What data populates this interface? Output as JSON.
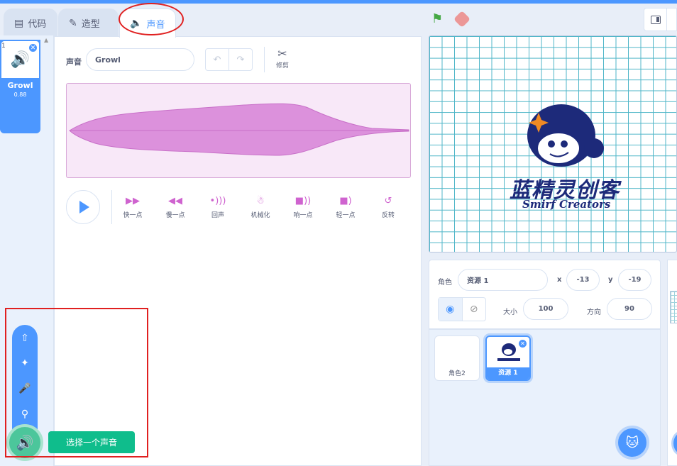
{
  "tabs": [
    {
      "label": "代码",
      "icon": "code-blocks-icon"
    },
    {
      "label": "造型",
      "icon": "brush-icon"
    },
    {
      "label": "声音",
      "icon": "speaker-icon"
    }
  ],
  "sound_list": {
    "items": [
      {
        "index": "1",
        "name": "Growl",
        "duration": "0.88"
      }
    ]
  },
  "editor": {
    "sound_label": "声音",
    "sound_name": "Growl",
    "trim_label": "修剪",
    "effects": [
      {
        "label": "快一点",
        "icon": "faster-icon"
      },
      {
        "label": "慢一点",
        "icon": "slower-icon"
      },
      {
        "label": "回声",
        "icon": "echo-icon"
      },
      {
        "label": "机械化",
        "icon": "robot-icon"
      },
      {
        "label": "响一点",
        "icon": "louder-icon"
      },
      {
        "label": "轻一点",
        "icon": "softer-icon"
      },
      {
        "label": "反转",
        "icon": "reverse-icon"
      }
    ],
    "waveform_color": "#cf63cf"
  },
  "add_sound": {
    "tooltip": "选择一个声音",
    "menu_icons": [
      "upload-icon",
      "surprise-icon",
      "microphone-icon",
      "search-icon"
    ]
  },
  "stage": {
    "logo_title": "蓝精灵创客",
    "logo_subtitle": "Smirf Creators"
  },
  "sprite_info": {
    "sprite_label": "角色",
    "sprite_name": "资源 1",
    "x_label": "x",
    "x_value": "-13",
    "y_label": "y",
    "y_value": "-19",
    "size_label": "大小",
    "size_value": "100",
    "direction_label": "方向",
    "direction_value": "90"
  },
  "sprites": [
    {
      "name": "角色2",
      "selected": false
    },
    {
      "name": "资源 1",
      "selected": true
    }
  ],
  "colors": {
    "accent": "#4c97ff",
    "highlight": "#e02020",
    "tooltip": "#0fbd8c"
  }
}
